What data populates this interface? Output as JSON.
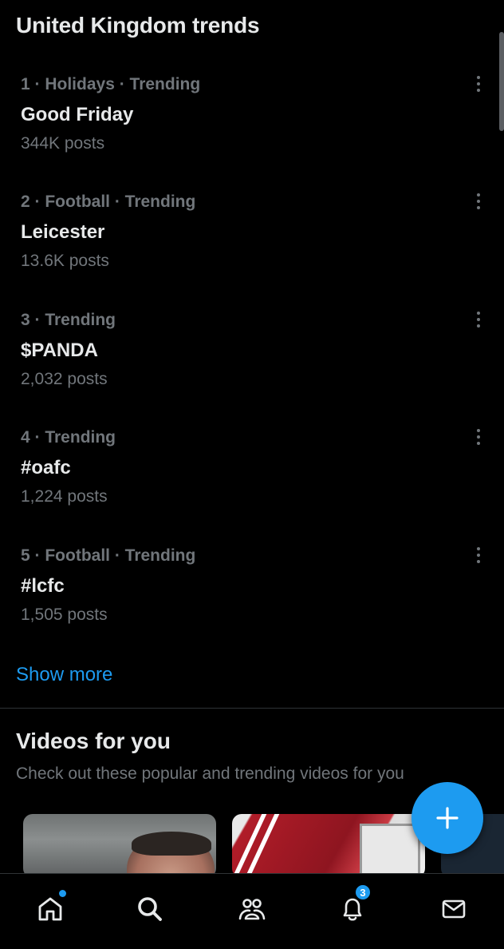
{
  "section_title": "United Kingdom trends",
  "trends": [
    {
      "meta": "1 · Holidays · Trending",
      "name": "Good Friday",
      "count": "344K posts"
    },
    {
      "meta": "2 · Football · Trending",
      "name": "Leicester",
      "count": "13.6K posts"
    },
    {
      "meta": "3 · Trending",
      "name": "$PANDA",
      "count": "2,032 posts"
    },
    {
      "meta": "4 · Trending",
      "name": "#oafc",
      "count": "1,224 posts"
    },
    {
      "meta": "5 · Football · Trending",
      "name": "#lcfc",
      "count": "1,505 posts"
    }
  ],
  "show_more": "Show more",
  "videos": {
    "title": "Videos for you",
    "subtitle": "Check out these popular and trending videos for you"
  },
  "tabbar": {
    "icons": [
      "home-icon",
      "search-icon",
      "communities-icon",
      "notifications-icon",
      "messages-icon"
    ],
    "notification_badge": "3"
  },
  "colors": {
    "accent": "#1d9bf0",
    "background": "#000000",
    "secondary_text": "#71767b",
    "primary_text": "#e7e9ea"
  }
}
